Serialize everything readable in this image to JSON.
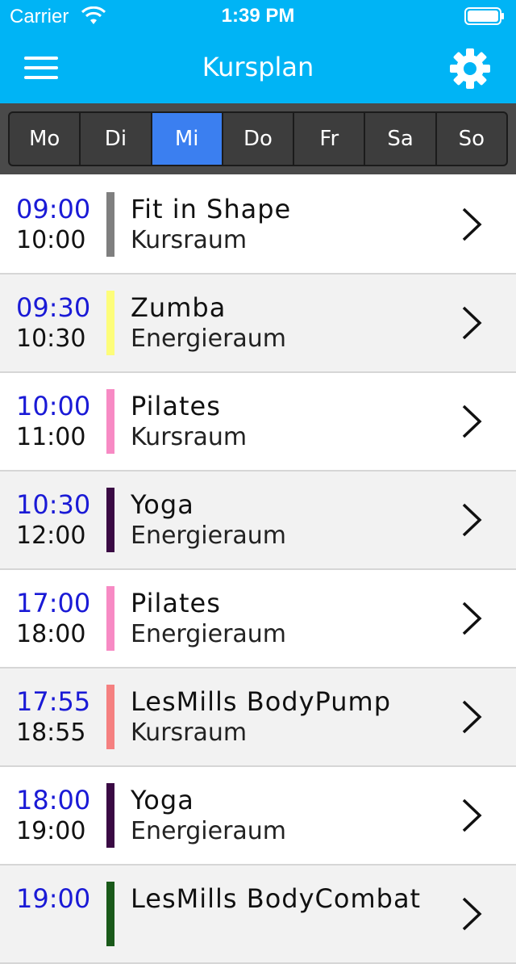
{
  "status_bar": {
    "carrier": "Carrier",
    "time": "1:39 PM",
    "wifi_icon": "wifi-icon",
    "battery_icon": "battery-icon"
  },
  "nav": {
    "title": "Kursplan",
    "menu_icon": "hamburger-menu-icon",
    "settings_icon": "gear-icon"
  },
  "days": {
    "items": [
      "Mo",
      "Di",
      "Mi",
      "Do",
      "Fr",
      "Sa",
      "So"
    ],
    "selected": "Mi"
  },
  "colors": {
    "header": "#00b4f5",
    "segment_active": "#3b7ff0",
    "start_time": "#1a1ad6"
  },
  "courses": [
    {
      "start": "09:00",
      "end": "10:00",
      "name": "Fit in Shape",
      "room": "Kursraum",
      "color": "#7f7f7f"
    },
    {
      "start": "09:30",
      "end": "10:30",
      "name": "Zumba",
      "room": "Energieraum",
      "color": "#fdfd7a"
    },
    {
      "start": "10:00",
      "end": "11:00",
      "name": "Pilates",
      "room": "Kursraum",
      "color": "#f78ac4"
    },
    {
      "start": "10:30",
      "end": "12:00",
      "name": "Yoga",
      "room": "Energieraum",
      "color": "#3a0a44"
    },
    {
      "start": "17:00",
      "end": "18:00",
      "name": "Pilates",
      "room": "Energieraum",
      "color": "#f78ac4"
    },
    {
      "start": "17:55",
      "end": "18:55",
      "name": "LesMills BodyPump",
      "room": "Kursraum",
      "color": "#f58080"
    },
    {
      "start": "18:00",
      "end": "19:00",
      "name": "Yoga",
      "room": "Energieraum",
      "color": "#3a0a44"
    },
    {
      "start": "19:00",
      "end": "",
      "name": "LesMills BodyCombat",
      "room": "",
      "color": "#1a5a1a"
    }
  ]
}
